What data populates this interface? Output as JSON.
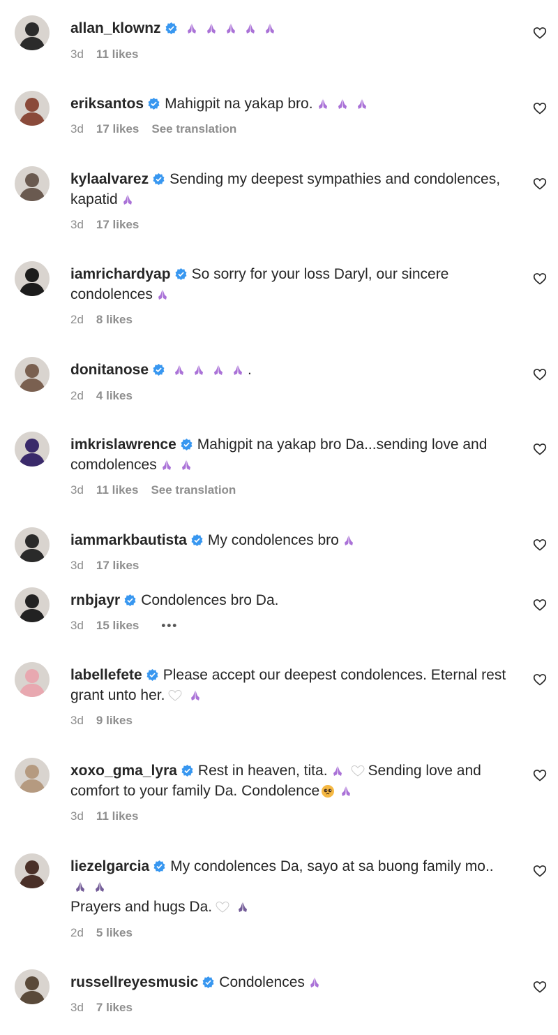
{
  "colors": {
    "verified": "#3897f0",
    "hands": "#9b59d0",
    "hands_dark": "#5b3f86",
    "meta": "#8e8e8e"
  },
  "icons": {
    "verified": "verified-badge-icon",
    "like": "heart-outline-icon",
    "folded_hands": "folded-hands-emoji",
    "white_heart": "white-heart-emoji",
    "pleading_face": "pleading-face-emoji",
    "more": "more-options-icon"
  },
  "comments": [
    {
      "username": "allan_klownz",
      "time": "3d",
      "likes": "11 likes",
      "parts": [
        {
          "h": 5
        }
      ]
    },
    {
      "username": "eriksantos",
      "time": "3d",
      "likes": "17 likes",
      "translation": "See translation",
      "parts": [
        {
          "t": "Mahigpit na yakap bro."
        },
        {
          "h": 3
        }
      ]
    },
    {
      "username": "kylaalvarez",
      "time": "3d",
      "likes": "17 likes",
      "parts": [
        {
          "t": "Sending my deepest sympathies and condolences, kapatid"
        },
        {
          "h": 1
        }
      ]
    },
    {
      "username": "iamrichardyap",
      "time": "2d",
      "likes": "8 likes",
      "parts": [
        {
          "t": "So sorry for your loss Daryl, our sincere condolences"
        },
        {
          "h": 1
        }
      ]
    },
    {
      "username": "donitanose",
      "time": "2d",
      "likes": "4 likes",
      "parts": [
        {
          "h": 4
        },
        {
          "t": "."
        }
      ]
    },
    {
      "username": "imkrislawrence",
      "time": "3d",
      "likes": "11 likes",
      "translation": "See translation",
      "parts": [
        {
          "t": "Mahigpit na yakap bro Da...sending love and comdolences"
        },
        {
          "h": 2
        }
      ]
    },
    {
      "username": "iammarkbautista",
      "time": "3d",
      "likes": "17 likes",
      "parts": [
        {
          "t": "My condolences bro"
        },
        {
          "h": 1
        }
      ]
    },
    {
      "username": "rnbjayr",
      "time": "3d",
      "likes": "15 likes",
      "more": "•••",
      "parts": [
        {
          "t": "Condolences bro Da."
        }
      ]
    },
    {
      "username": "labellefete",
      "time": "3d",
      "likes": "9 likes",
      "parts": [
        {
          "t": "Please accept our deepest condolences. Eternal rest grant unto her."
        },
        {
          "w": 1
        },
        {
          "h": 1
        }
      ]
    },
    {
      "username": "xoxo_gma_lyra",
      "time": "3d",
      "likes": "11 likes",
      "parts": [
        {
          "t": "Rest in heaven, tita."
        },
        {
          "h": 1
        },
        {
          "w": 1
        },
        {
          "t": "Sending love and comfort to your family Da. Condolence"
        },
        {
          "f": 1
        },
        {
          "h": 1
        }
      ]
    },
    {
      "username": "liezelgarcia",
      "time": "2d",
      "likes": "5 likes",
      "parts": [
        {
          "t": "My condolences Da, sayo at sa buong family mo.."
        },
        {
          "hd": 2
        },
        {
          "br": 1
        },
        {
          "t": "Prayers and hugs Da."
        },
        {
          "w": 1
        },
        {
          "hd": 1
        }
      ]
    },
    {
      "username": "russellreyesmusic",
      "time": "3d",
      "likes": "7 likes",
      "parts": [
        {
          "t": "Condolences"
        },
        {
          "h": 1
        }
      ]
    }
  ]
}
